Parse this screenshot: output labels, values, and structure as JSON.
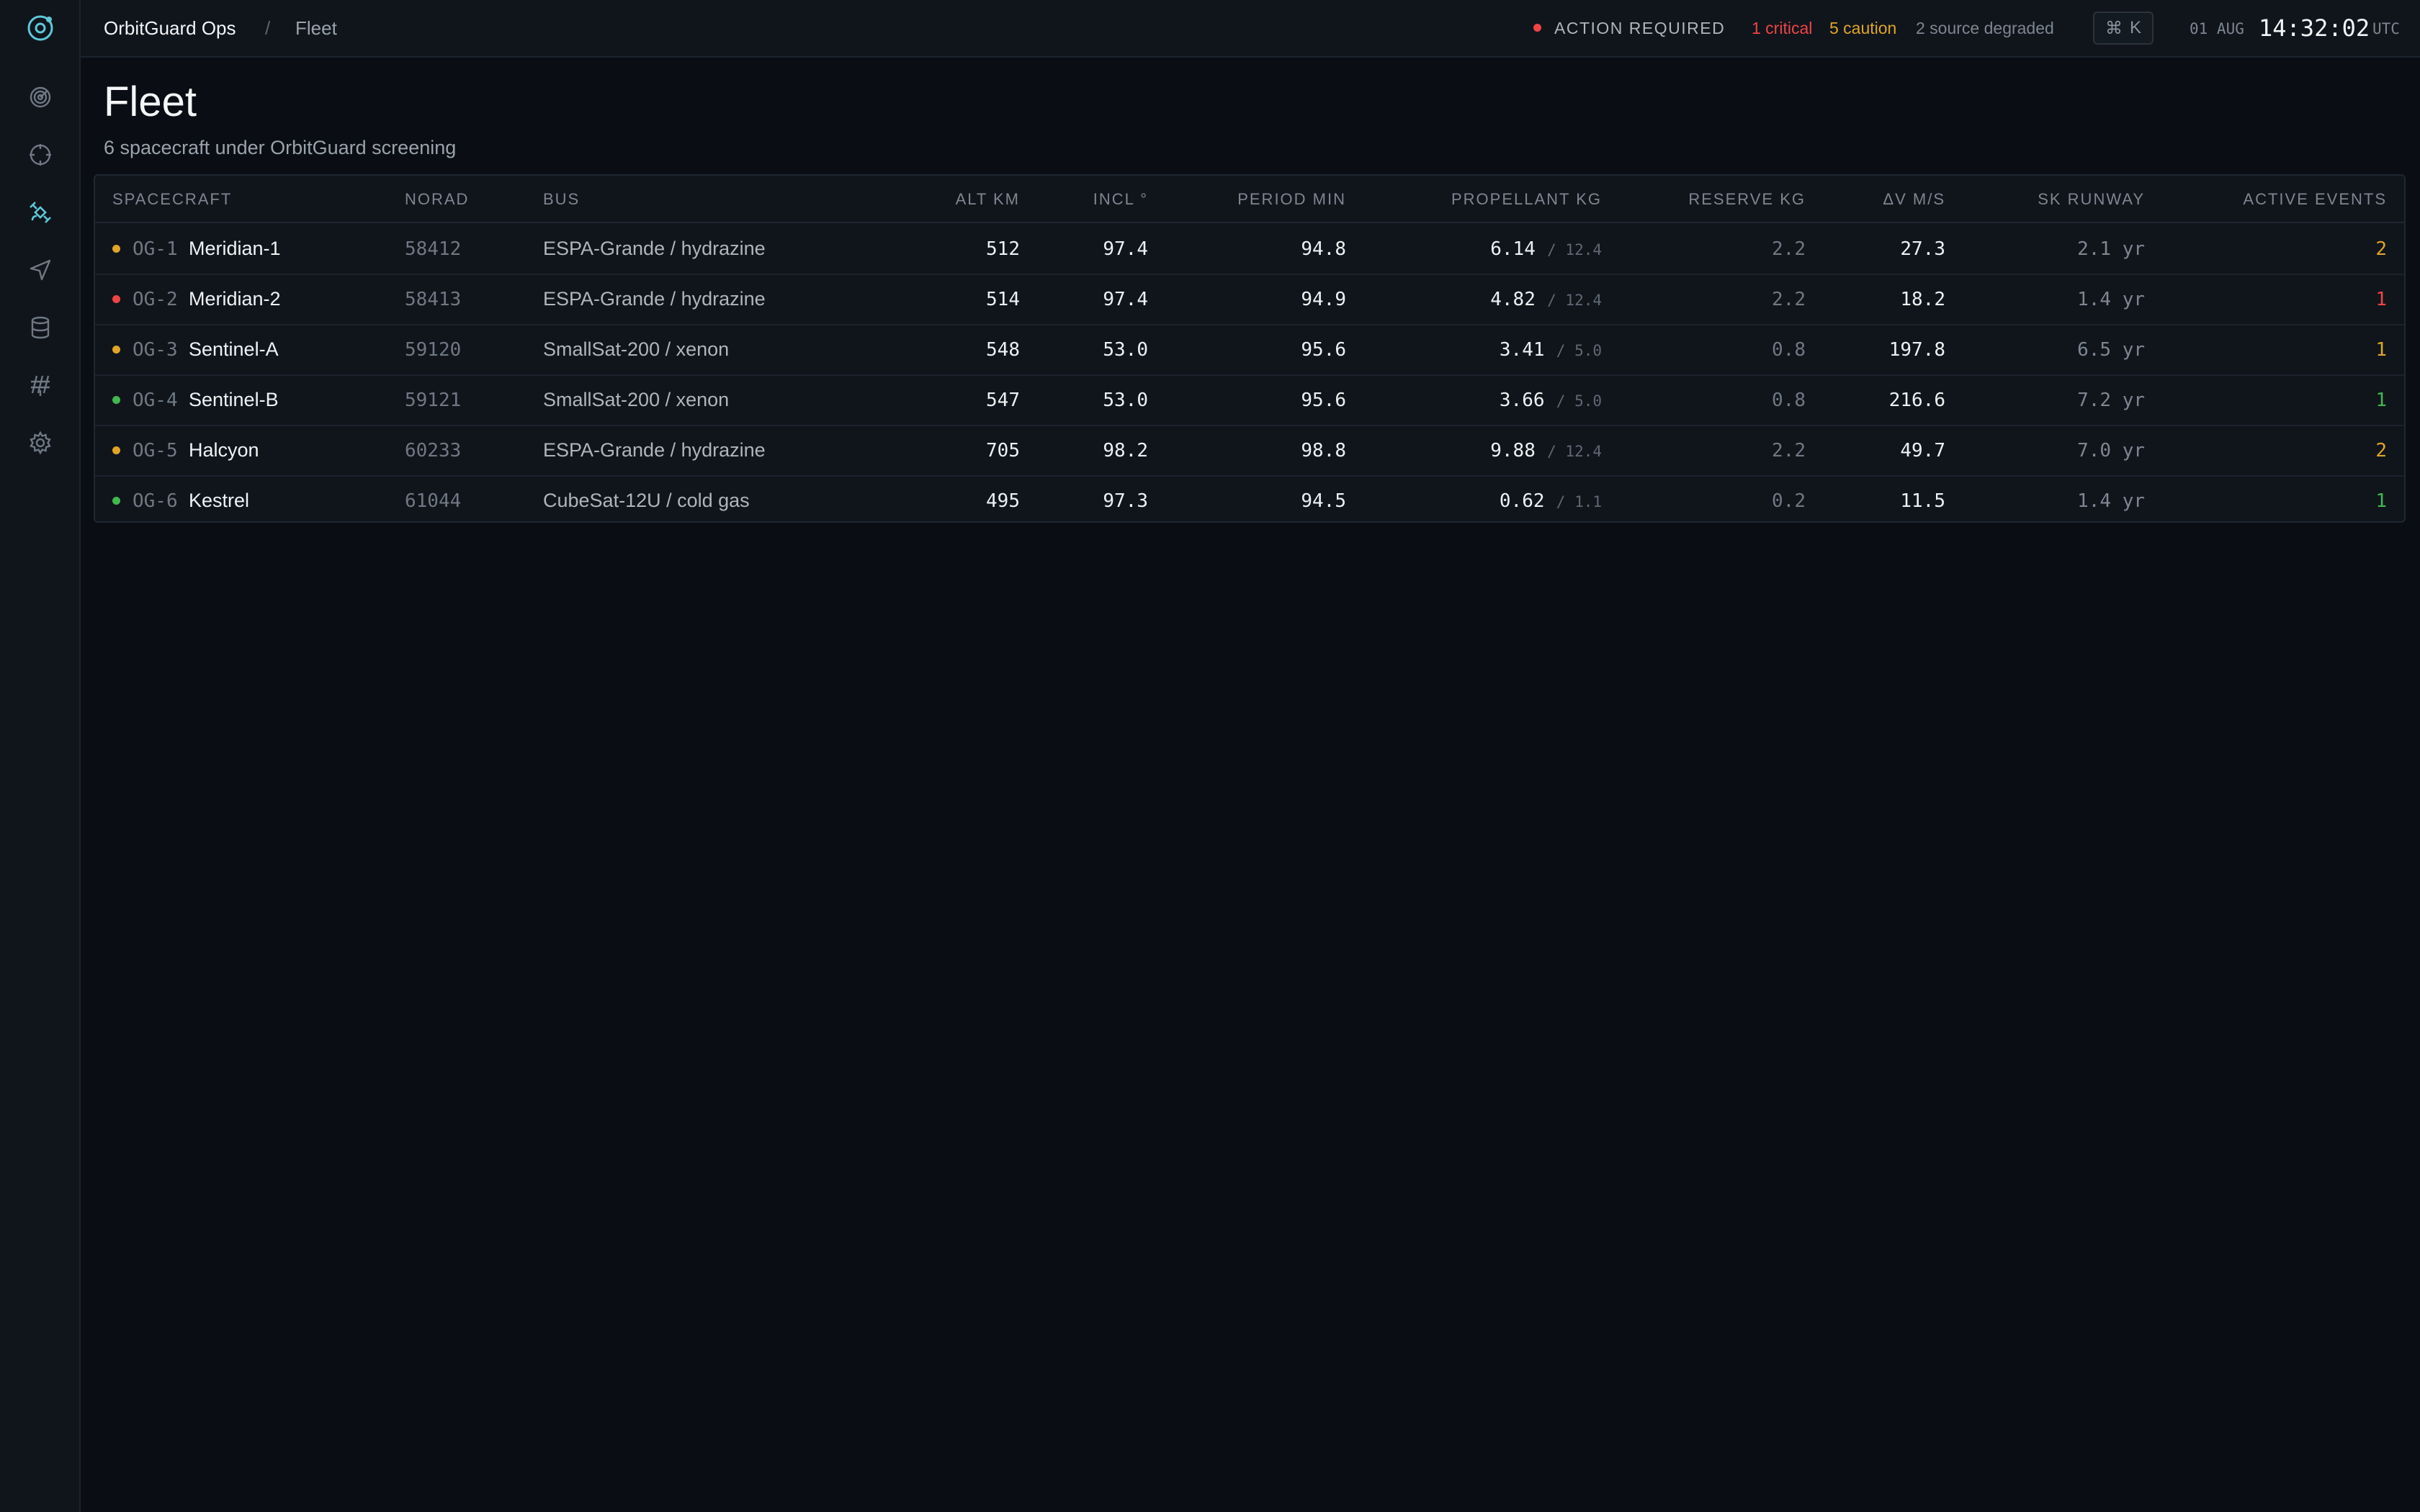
{
  "app": {
    "name": "OrbitGuard Ops",
    "separator": "/",
    "current_page": "Fleet"
  },
  "colors": {
    "accent": "#5ec8d8",
    "critical": "#ef4444",
    "caution": "#e0a526",
    "nominal": "#3fb950"
  },
  "rail": {
    "logo_icon": "orbit-logo-icon",
    "items": [
      {
        "icon": "radar-icon",
        "active": false
      },
      {
        "icon": "crosshair-icon",
        "active": false
      },
      {
        "icon": "satellite-icon",
        "active": true
      },
      {
        "icon": "send-icon",
        "active": false
      },
      {
        "icon": "database-icon",
        "active": false
      },
      {
        "icon": "antenna-icon",
        "active": false
      },
      {
        "icon": "gear-icon",
        "active": false
      }
    ]
  },
  "status": {
    "label": "ACTION REQUIRED",
    "critical": "1 critical",
    "caution": "5 caution",
    "degraded": "2 source degraded"
  },
  "shortcut": {
    "symbol": "⌘",
    "key": "K"
  },
  "clock": {
    "date": "01 AUG",
    "time": "14:32:02",
    "tz": "UTC"
  },
  "page": {
    "title": "Fleet",
    "subtitle": "6 spacecraft under OrbitGuard screening"
  },
  "table": {
    "columns": {
      "spacecraft": "SPACECRAFT",
      "norad": "NORAD",
      "bus": "BUS",
      "alt": "ALT KM",
      "incl": "INCL °",
      "period": "PERIOD MIN",
      "propellant": "PROPELLANT KG",
      "reserve": "RESERVE KG",
      "dv": "ΔV M/S",
      "runway": "SK RUNWAY",
      "events": "ACTIVE EVENTS"
    },
    "rows": [
      {
        "status": "caution",
        "id": "OG-1",
        "name": "Meridian-1",
        "norad": "58412",
        "bus": "ESPA-Grande / hydrazine",
        "alt": "512",
        "incl": "97.4",
        "period": "94.8",
        "prop": "6.14",
        "prop_max": "/ 12.4",
        "reserve": "2.2",
        "dv": "27.3",
        "runway": "2.1 yr",
        "events": "2"
      },
      {
        "status": "critical",
        "id": "OG-2",
        "name": "Meridian-2",
        "norad": "58413",
        "bus": "ESPA-Grande / hydrazine",
        "alt": "514",
        "incl": "97.4",
        "period": "94.9",
        "prop": "4.82",
        "prop_max": "/ 12.4",
        "reserve": "2.2",
        "dv": "18.2",
        "runway": "1.4 yr",
        "events": "1"
      },
      {
        "status": "caution",
        "id": "OG-3",
        "name": "Sentinel-A",
        "norad": "59120",
        "bus": "SmallSat-200 / xenon",
        "alt": "548",
        "incl": "53.0",
        "period": "95.6",
        "prop": "3.41",
        "prop_max": "/ 5.0",
        "reserve": "0.8",
        "dv": "197.8",
        "runway": "6.5 yr",
        "events": "1"
      },
      {
        "status": "nominal",
        "id": "OG-4",
        "name": "Sentinel-B",
        "norad": "59121",
        "bus": "SmallSat-200 / xenon",
        "alt": "547",
        "incl": "53.0",
        "period": "95.6",
        "prop": "3.66",
        "prop_max": "/ 5.0",
        "reserve": "0.8",
        "dv": "216.6",
        "runway": "7.2 yr",
        "events": "1"
      },
      {
        "status": "caution",
        "id": "OG-5",
        "name": "Halcyon",
        "norad": "60233",
        "bus": "ESPA-Grande / hydrazine",
        "alt": "705",
        "incl": "98.2",
        "period": "98.8",
        "prop": "9.88",
        "prop_max": "/ 12.4",
        "reserve": "2.2",
        "dv": "49.7",
        "runway": "7.0 yr",
        "events": "2"
      },
      {
        "status": "nominal",
        "id": "OG-6",
        "name": "Kestrel",
        "norad": "61044",
        "bus": "CubeSat-12U / cold gas",
        "alt": "495",
        "incl": "97.3",
        "period": "94.5",
        "prop": "0.62",
        "prop_max": "/ 1.1",
        "reserve": "0.2",
        "dv": "11.5",
        "runway": "1.4 yr",
        "events": "1"
      }
    ]
  }
}
